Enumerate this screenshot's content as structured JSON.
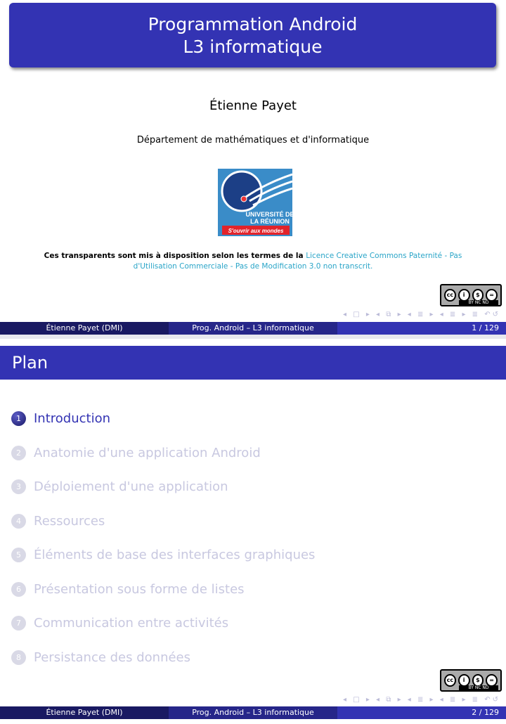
{
  "slide1": {
    "title_line1": "Programmation Android",
    "title_line2": "L3 informatique",
    "author": "Étienne Payet",
    "institute": "Département de mathématiques et d'informatique",
    "logo": {
      "line1": "UNIVERSITÉ DE",
      "line2": "LA RÉUNION",
      "tagline": "S'ouvrir aux mondes"
    },
    "license_prefix": "Ces transparents sont mis à disposition selon les termes de la ",
    "license_link": "Licence Creative Commons Paternité - Pas d'Utilisation Commerciale - Pas de Modification 3.0 non transcrit.",
    "cc_badge": "BY NC ND",
    "nav_symbols": "◂ □ ▸ ◂ ⧉ ▸ ◂ ≣ ▸ ◂ ≣ ▸ ≣ ↶↺",
    "footer": {
      "author": "Étienne Payet  (DMI)",
      "title": "Prog. Android – L3 informatique",
      "page": "1 / 129"
    }
  },
  "slide2": {
    "title": "Plan",
    "toc": [
      {
        "num": "1",
        "label": "Introduction"
      },
      {
        "num": "2",
        "label": "Anatomie d'une application Android"
      },
      {
        "num": "3",
        "label": "Déploiement d'une application"
      },
      {
        "num": "4",
        "label": "Ressources"
      },
      {
        "num": "5",
        "label": "Éléments de base des interfaces graphiques"
      },
      {
        "num": "6",
        "label": "Présentation sous forme de listes"
      },
      {
        "num": "7",
        "label": "Communication entre activités"
      },
      {
        "num": "8",
        "label": "Persistance des données"
      }
    ],
    "cc_badge": "BY NC ND",
    "nav_symbols": "◂ □ ▸ ◂ ⧉ ▸ ◂ ≣ ▸ ◂ ≣ ▸ ≣ ↶↺",
    "footer": {
      "author": "Étienne Payet  (DMI)",
      "title": "Prog. Android – L3 informatique",
      "page": "2 / 129"
    }
  }
}
